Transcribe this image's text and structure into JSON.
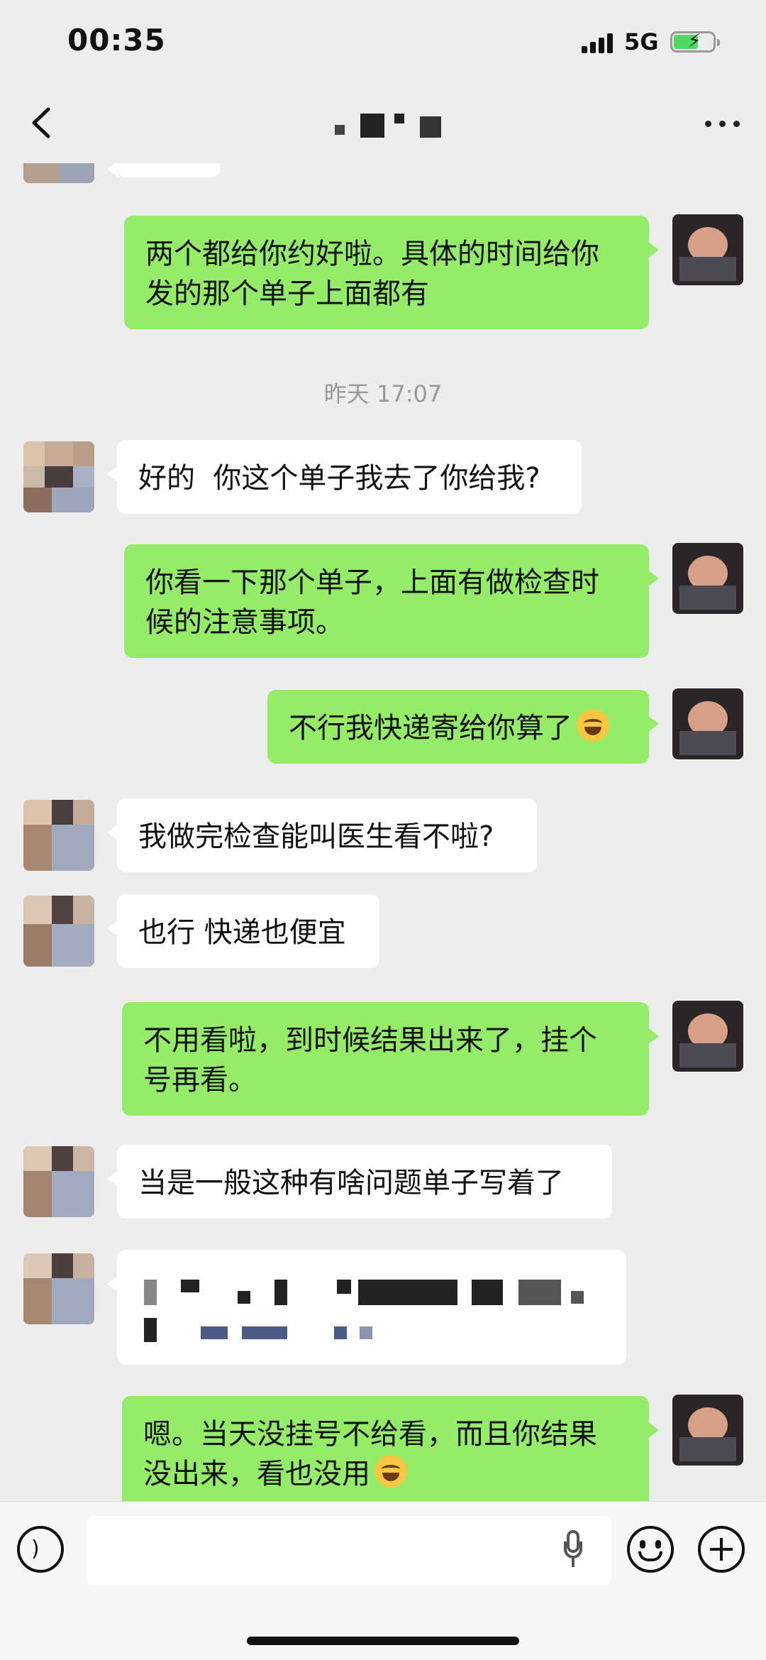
{
  "status_bar": {
    "time": "00:35",
    "network": "5G",
    "battery_level": 0.6
  },
  "nav": {
    "back": "back",
    "more": "more"
  },
  "messages": [
    {
      "sender": "me",
      "text": "两个都给你约好啦。具体的时间给你\n发的那个单子上面都有"
    },
    {
      "type": "timestamp",
      "text": "昨天 17:07"
    },
    {
      "sender": "other",
      "text": "好的  你这个单子我去了你给我?"
    },
    {
      "sender": "me",
      "text": "你看一下那个单子，上面有做检查时\n候的注意事项。"
    },
    {
      "sender": "me",
      "text": "不行我快递寄给你算了",
      "emoji": "laughing-with-tears"
    },
    {
      "sender": "other",
      "text": "我做完检查能叫医生看不啦?"
    },
    {
      "sender": "other",
      "text": "也行 快递也便宜"
    },
    {
      "sender": "me",
      "text": "不用看啦，到时候结果出来了，挂个\n号再看。"
    },
    {
      "sender": "other",
      "text": "当是一般这种有啥问题单子写着了"
    },
    {
      "sender": "other",
      "redacted": true
    },
    {
      "sender": "me",
      "text": "嗯。当天没挂号不给看，而且你结果\n没出来，看也没用",
      "emoji": "laughing-with-tears"
    }
  ],
  "input_bar": {
    "placeholder": "",
    "icons": [
      "voice-icon",
      "microphone-icon",
      "emoji-icon",
      "plus-icon"
    ]
  },
  "colors": {
    "my_bubble": "#95ec69",
    "other_bubble": "#ffffff",
    "background": "#ededed"
  }
}
